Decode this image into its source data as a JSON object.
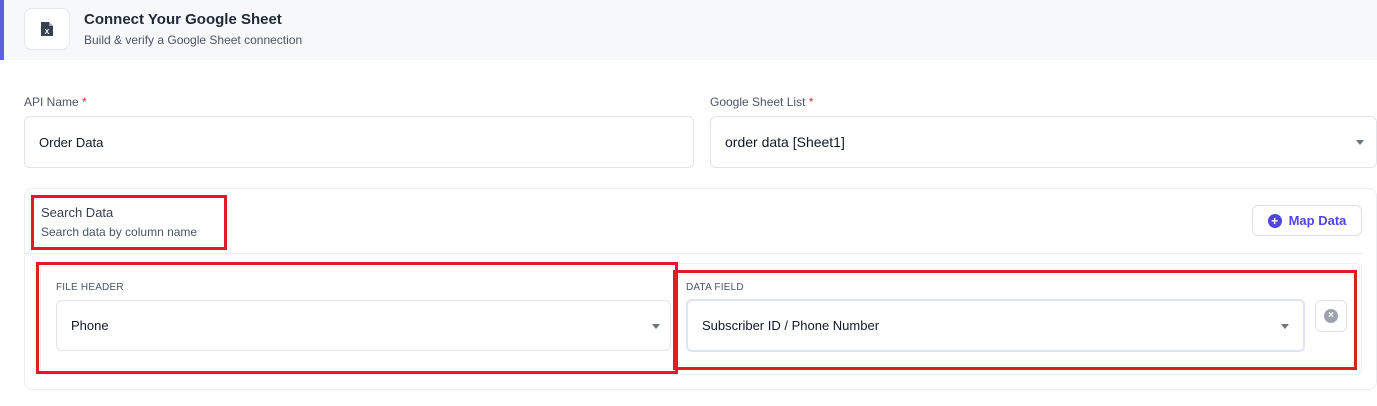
{
  "header": {
    "title": "Connect Your Google Sheet",
    "subtitle": "Build & verify a Google Sheet connection",
    "icon": "spreadsheet-icon"
  },
  "form": {
    "api_name": {
      "label": "API Name",
      "required_mark": "*",
      "value": "Order Data"
    },
    "sheet_list": {
      "label": "Google Sheet List",
      "required_mark": "*",
      "selected": "order data [Sheet1]"
    }
  },
  "search": {
    "title": "Search Data",
    "subtitle": "Search data by column name",
    "map_button_label": "Map Data",
    "mapping": {
      "file_header_label": "FILE HEADER",
      "file_header_value": "Phone",
      "data_field_label": "DATA FIELD",
      "data_field_value": "Subscriber ID / Phone Number"
    }
  },
  "colors": {
    "accent": "#4f46e5",
    "highlight": "#e01b24",
    "header_border": "#5b5fe0"
  }
}
